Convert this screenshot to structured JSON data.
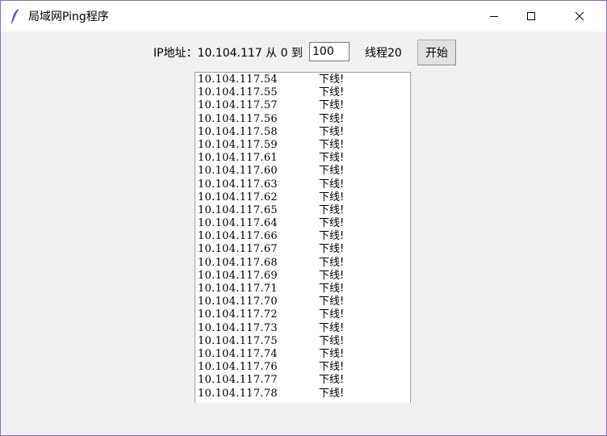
{
  "window": {
    "title": "局域网Ping程序"
  },
  "toolbar": {
    "ip_label": "IP地址：10.104.117 从 0 到",
    "end_value": "100",
    "thread_label": "线程20",
    "start_label": "开始"
  },
  "results": [
    {
      "ip": "10.104.117.54",
      "status": "下线!"
    },
    {
      "ip": "10.104.117.55",
      "status": "下线!"
    },
    {
      "ip": "10.104.117.57",
      "status": "下线!"
    },
    {
      "ip": "10.104.117.56",
      "status": "下线!"
    },
    {
      "ip": "10.104.117.58",
      "status": "下线!"
    },
    {
      "ip": "10.104.117.59",
      "status": "下线!"
    },
    {
      "ip": "10.104.117.61",
      "status": "下线!"
    },
    {
      "ip": "10.104.117.60",
      "status": "下线!"
    },
    {
      "ip": "10.104.117.63",
      "status": "下线!"
    },
    {
      "ip": "10.104.117.62",
      "status": "下线!"
    },
    {
      "ip": "10.104.117.65",
      "status": "下线!"
    },
    {
      "ip": "10.104.117.64",
      "status": "下线!"
    },
    {
      "ip": "10.104.117.66",
      "status": "下线!"
    },
    {
      "ip": "10.104.117.67",
      "status": "下线!"
    },
    {
      "ip": "10.104.117.68",
      "status": "下线!"
    },
    {
      "ip": "10.104.117.69",
      "status": "下线!"
    },
    {
      "ip": "10.104.117.71",
      "status": "下线!"
    },
    {
      "ip": "10.104.117.70",
      "status": "下线!"
    },
    {
      "ip": "10.104.117.72",
      "status": "下线!"
    },
    {
      "ip": "10.104.117.73",
      "status": "下线!"
    },
    {
      "ip": "10.104.117.75",
      "status": "下线!"
    },
    {
      "ip": "10.104.117.74",
      "status": "下线!"
    },
    {
      "ip": "10.104.117.76",
      "status": "下线!"
    },
    {
      "ip": "10.104.117.77",
      "status": "下线!"
    },
    {
      "ip": "10.104.117.78",
      "status": "下线!"
    }
  ]
}
